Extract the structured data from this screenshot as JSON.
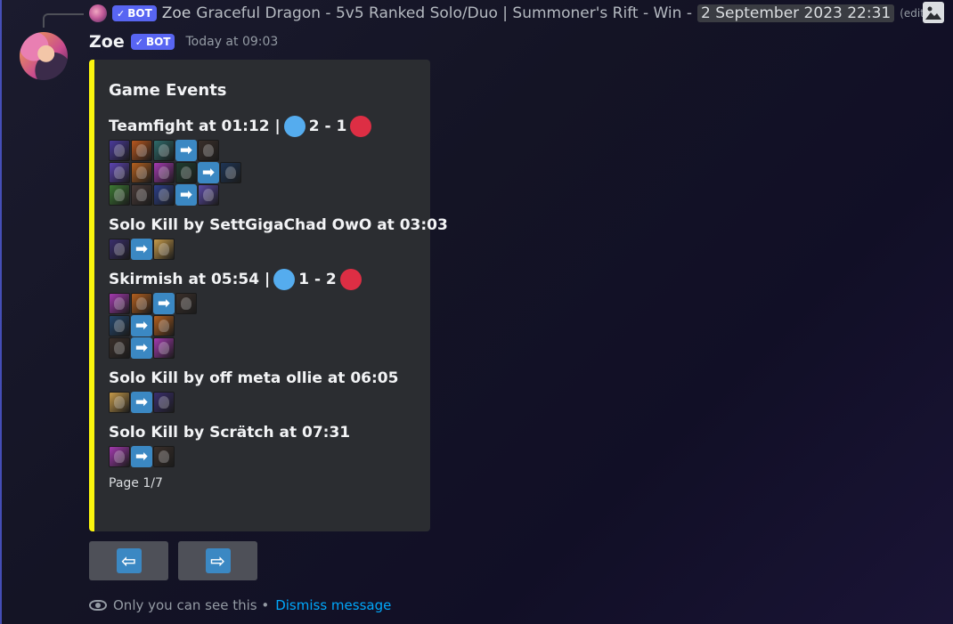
{
  "reply": {
    "bot_tag": "BOT",
    "author": "Zoe",
    "content": "Graceful Dragon - 5v5 Ranked Solo/Duo | Summoner's Rift - Win -",
    "date": "2 September 2023 22:31",
    "edited": "(edited)"
  },
  "message": {
    "author": "Zoe",
    "bot_tag": "BOT",
    "timestamp": "Today at 09:03"
  },
  "embed": {
    "accent_color": "#fbf50e",
    "title": "Game Events",
    "events": [
      {
        "title": "Teamfight at 01:12 |",
        "score_blue": "2 - 1",
        "rows": [
          [
            "#4b3a9c",
            "#b9571e",
            "#2e6b6b",
            "arrow",
            "#3a2f2a"
          ],
          [
            "#5d44b3",
            "#b4601f",
            "#a43ab0",
            "#1f3d2f",
            "arrow",
            "#1e3556"
          ],
          [
            "#3d7a34",
            "#4a3b38",
            "#2c3f8a",
            "arrow",
            "#5c4aa8"
          ]
        ]
      },
      {
        "title": "Solo Kill by SettGigaChad OwO at 03:03",
        "rows": [
          [
            "#3a2e6e",
            "arrow",
            "#c79b4a"
          ]
        ]
      },
      {
        "title": "Skirmish at 05:54 |",
        "score_blue": "1 - 2",
        "rows": [
          [
            "#a43ab0",
            "#b4601f",
            "arrow",
            "#3a2f2a"
          ],
          [
            "#24476e",
            "arrow",
            "#b4601f"
          ],
          [
            "#3a2f2a",
            "arrow",
            "#a43ab0"
          ]
        ]
      },
      {
        "title": "Solo Kill by off meta ollie at 06:05",
        "rows": [
          [
            "#c79b4a",
            "arrow",
            "#3a2e6e"
          ]
        ]
      },
      {
        "title": "Solo Kill by Scrätch at 07:31",
        "rows": [
          [
            "#a43ab0",
            "arrow",
            "#3a2f2a"
          ]
        ]
      }
    ],
    "footer": "Page 1/7"
  },
  "buttons": {
    "prev_icon": "left-arrow-icon",
    "next_icon": "right-arrow-icon",
    "prev_glyph": "⇦",
    "next_glyph": "⇨"
  },
  "ephemeral": {
    "notice": "Only you can see this •",
    "dismiss": "Dismiss message"
  },
  "colors": {
    "team_blue": "#55acee",
    "team_red": "#dd2e44",
    "arrow": "#3b88c3",
    "bot_tag": "#5865f2",
    "link": "#00a8fc"
  }
}
